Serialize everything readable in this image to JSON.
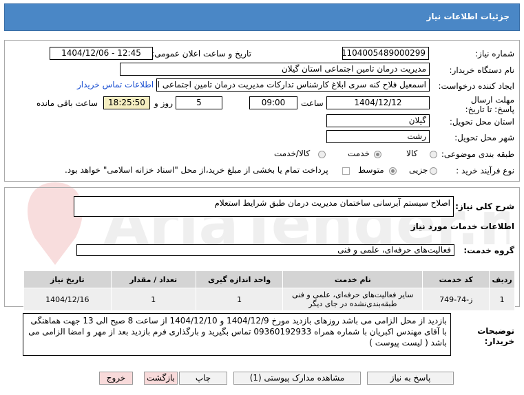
{
  "header": {
    "title": "جزئیات اطلاعات نیاز"
  },
  "form": {
    "need_number_label": "شماره نیاز:",
    "need_number": "1104005489000299",
    "announce_label": "تاریخ و ساعت اعلان عمومی:",
    "announce_value": "1404/12/06 - 12:45",
    "buyer_label": "نام دستگاه خریدار:",
    "buyer_value": "مدیریت درمان تامین اجتماعی استان گیلان",
    "creator_label": "ایجاد کننده درخواست:",
    "creator_value": "اسمعیل فلاح کنه سری ابلاغ کارشناس تدارکات مدیریت درمان تامین اجتماعی اد",
    "contact_link": "اطلاعات تماس خریدار",
    "deadline_label": "مهلت ارسال پاسخ: تا تاریخ:",
    "deadline_date": "1404/12/12",
    "time_label": "ساعت",
    "deadline_time": "09:00",
    "days_value": "5",
    "days_label": "روز و",
    "remaining_time": "18:25:50",
    "remaining_label": "ساعت باقی مانده",
    "province_label": "استان محل تحویل:",
    "province_value": "گیلان",
    "city_label": "شهر محل تحویل:",
    "city_value": "رشت",
    "category_label": "طبقه بندی موضوعی:",
    "category_options": [
      "کالا",
      "خدمت",
      "کالا/خدمت"
    ],
    "process_label": "نوع فرآیند خرید :",
    "process_options": [
      "جزیی",
      "متوسط"
    ],
    "payment_note": "پرداخت تمام یا بخشی از مبلغ خرید،از محل \"اسناد خزانه اسلامی\" خواهد بود."
  },
  "summary": {
    "label": "شرح کلی نیاز:",
    "value": "اصلاح سیستم آبرسانی ساختمان مدیریت درمان طبق شرایط استعلام"
  },
  "services": {
    "section_title": "اطلاعات خدمات مورد نیاز",
    "group_label": "گروه خدمت:",
    "group_value": "فعالیت‌های حرفه‌ای، علمی و فنی"
  },
  "table": {
    "headers": [
      "ردیف",
      "کد خدمت",
      "نام خدمت",
      "واحد اندازه گیری",
      "تعداد / مقدار",
      "تاریخ نیاز"
    ],
    "rows": [
      {
        "row": "1",
        "code": "ز-74-749",
        "name": "سایر فعالیت‌های حرفه‌ای، علمی و فنی طبقه‌بندی‌نشده در جای دیگر",
        "unit": "1",
        "qty": "1",
        "date": "1404/12/16"
      }
    ]
  },
  "notes": {
    "label": "توضیحات خریدار:",
    "value": "بازدید از محل الزامی می باشد روزهای بازدید مورخ 1404/12/9 و 1404/12/10 از ساعت 8 صبح الی 13 جهت هماهنگی با آقای مهندس اکبریان با شماره همراه 09360192933 تماس بگیرید و بارگذاری فرم بازدید بعد از مهر و امضا الزامی می باشد ( لیست پیوست )"
  },
  "buttons": {
    "reply": "پاسخ به نیاز",
    "attachments": "مشاهده مدارک پیوستی (1)",
    "print": "چاپ",
    "back": "بازگشت",
    "exit": "خروج"
  },
  "watermark": {
    "text": "AriaTender.net"
  },
  "colors": {
    "title_bar": "#4a87c6",
    "link": "#1a4fd1",
    "table_header": "#d4d4d4",
    "remaining_bg": "#f5eec1"
  }
}
